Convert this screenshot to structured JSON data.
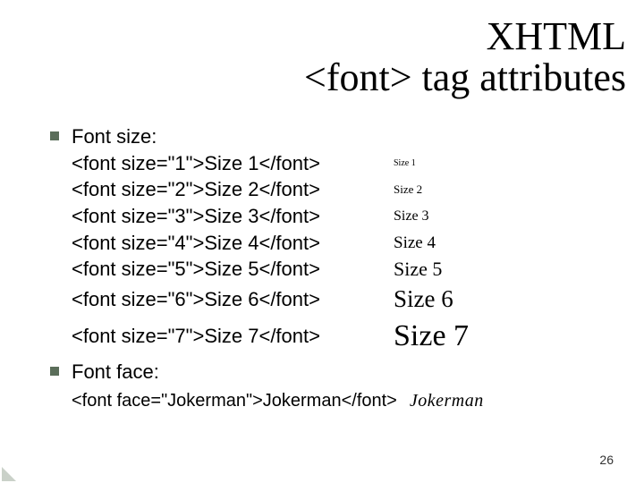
{
  "title_line1": "XHTML",
  "title_line2": "<font> tag attributes",
  "bullets": {
    "size_label": "Font size:",
    "face_label": "Font face:"
  },
  "sizes": [
    {
      "code": "<font size=\"1\">Size 1</font>",
      "example": "Size 1"
    },
    {
      "code": "<font size=\"2\">Size 2</font>",
      "example": "Size 2"
    },
    {
      "code": "<font size=\"3\">Size 3</font>",
      "example": "Size 3"
    },
    {
      "code": "<font size=\"4\">Size 4</font>",
      "example": "Size 4"
    },
    {
      "code": "<font size=\"5\">Size 5</font>",
      "example": "Size 5"
    },
    {
      "code": "<font size=\"6\">Size 6</font>",
      "example": "Size 6"
    },
    {
      "code": "<font size=\"7\">Size 7</font>",
      "example": "Size 7"
    }
  ],
  "face": {
    "code": "<font face=\"Jokerman\">Jokerman</font>",
    "example": "Jokerman"
  },
  "page_number": "26"
}
